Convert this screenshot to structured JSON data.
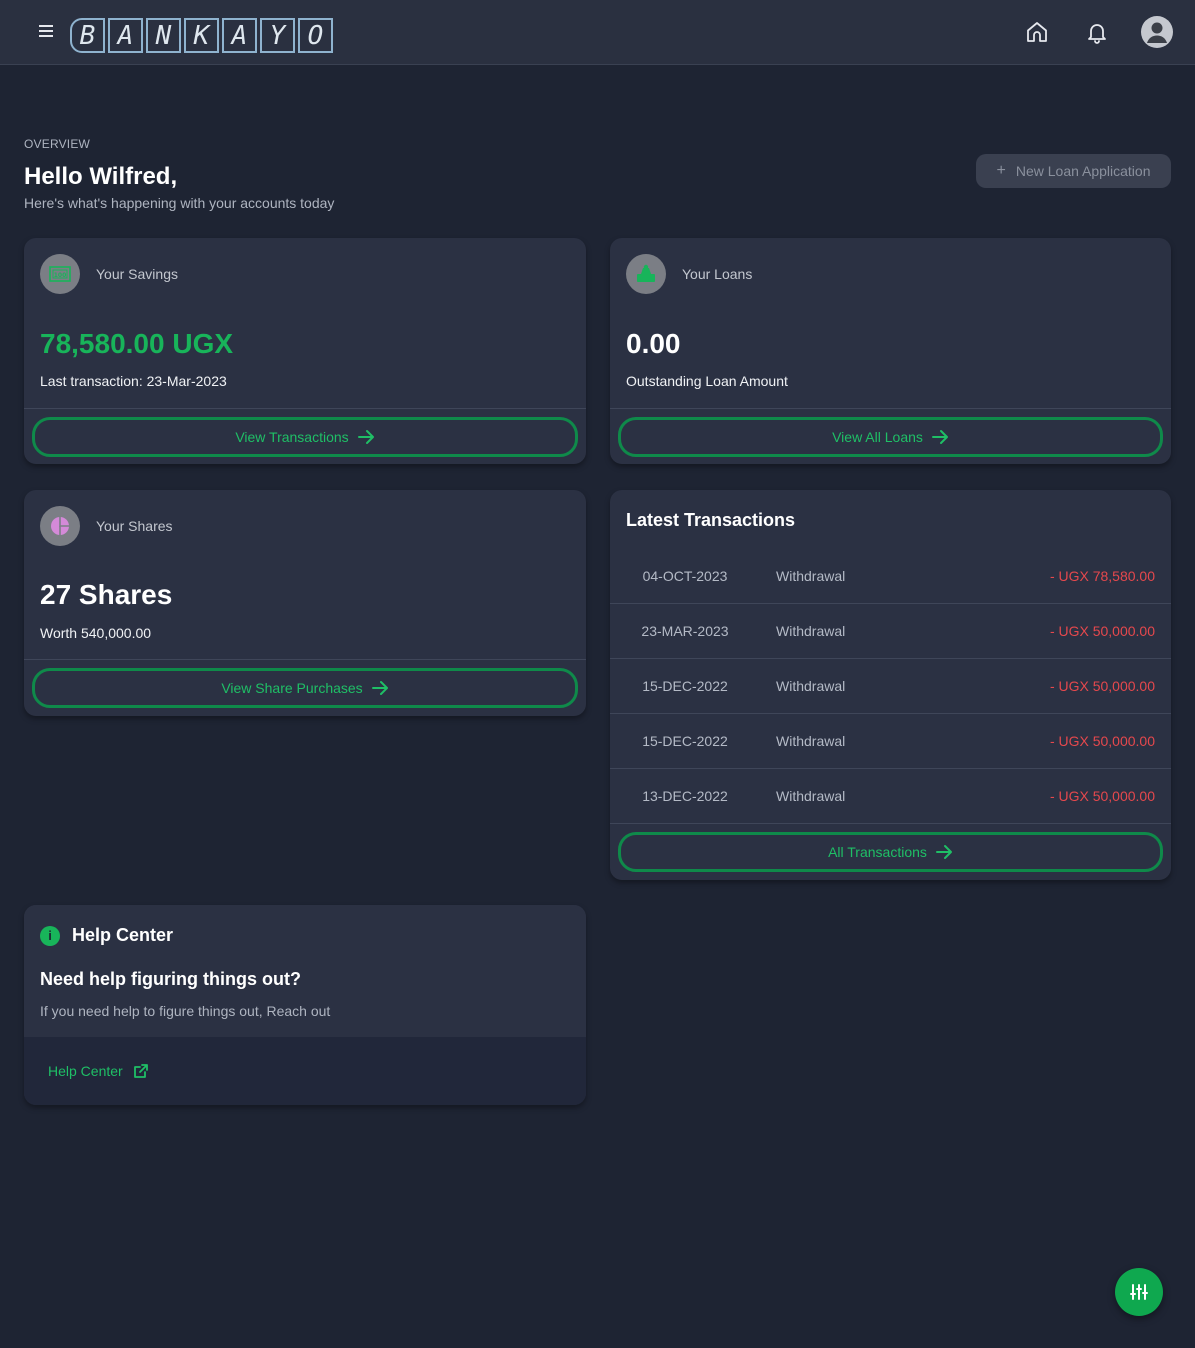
{
  "header": {
    "logo_letters": [
      "B",
      "A",
      "N",
      "K",
      "A",
      "Y",
      "O"
    ]
  },
  "page": {
    "section_label": "OVERVIEW",
    "greeting": "Hello Wilfred,",
    "subtitle": "Here's what's happening with your accounts today",
    "new_loan_label": "New Loan Application"
  },
  "savings": {
    "label": "Your Savings",
    "amount": "78,580.00 UGX",
    "last_transaction": "Last transaction: 23-Mar-2023",
    "button": "View Transactions"
  },
  "loans": {
    "label": "Your Loans",
    "amount": "0.00",
    "caption": "Outstanding Loan Amount",
    "button": "View All Loans"
  },
  "shares": {
    "label": "Your Shares",
    "amount": "27 Shares",
    "worth": "Worth 540,000.00",
    "button": "View Share Purchases"
  },
  "transactions": {
    "title": "Latest Transactions",
    "rows": [
      {
        "date": "04-OCT-2023",
        "type": "Withdrawal",
        "amount": "- UGX 78,580.00"
      },
      {
        "date": "23-MAR-2023",
        "type": "Withdrawal",
        "amount": "- UGX 50,000.00"
      },
      {
        "date": "15-DEC-2022",
        "type": "Withdrawal",
        "amount": "- UGX 50,000.00"
      },
      {
        "date": "15-DEC-2022",
        "type": "Withdrawal",
        "amount": "- UGX 50,000.00"
      },
      {
        "date": "13-DEC-2022",
        "type": "Withdrawal",
        "amount": "- UGX 50,000.00"
      }
    ],
    "button": "All Transactions"
  },
  "help": {
    "title": "Help Center",
    "question": "Need help figuring things out?",
    "text": "If you need help to figure things out, Reach out",
    "link": "Help Center"
  },
  "colors": {
    "accent_green": "#18b45a",
    "negative_red": "#e5484d",
    "background": "#1e2433",
    "card": "#2b3143"
  }
}
